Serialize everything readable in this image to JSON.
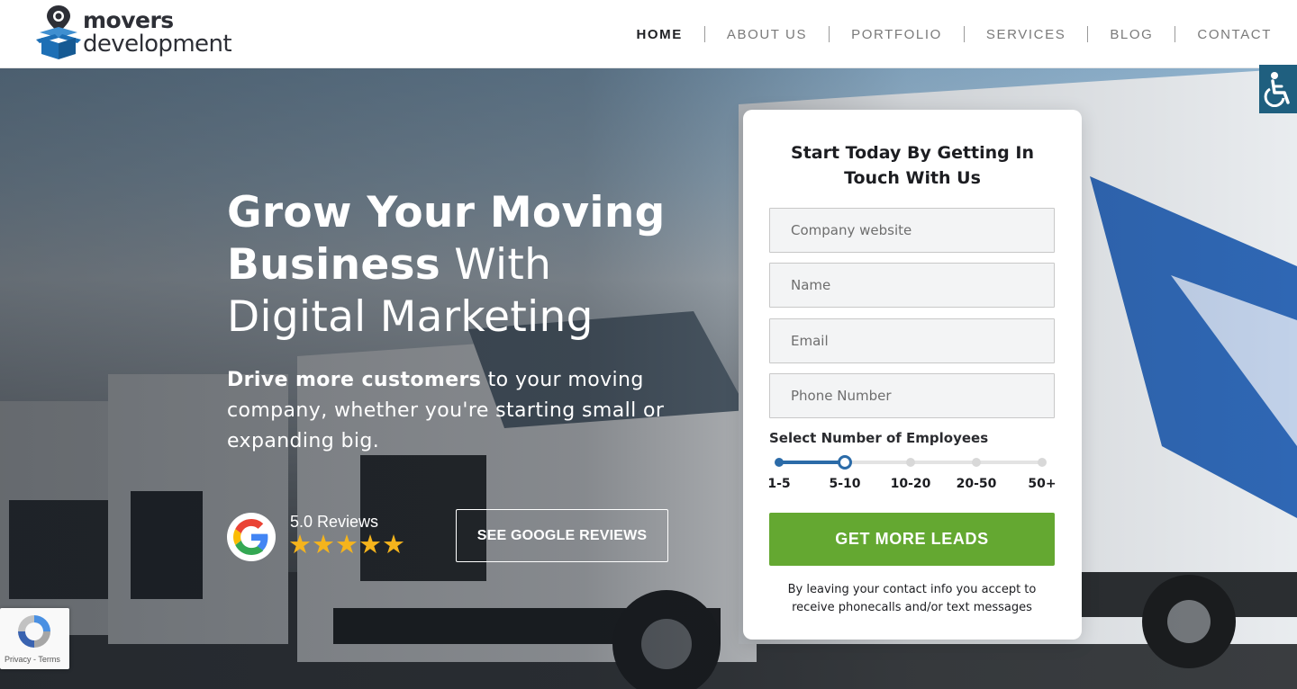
{
  "brand": {
    "line1": "movers",
    "line2": "development"
  },
  "nav": [
    {
      "label": "HOME",
      "active": true
    },
    {
      "label": "ABOUT US",
      "active": false
    },
    {
      "label": "PORTFOLIO",
      "active": false
    },
    {
      "label": "SERVICES",
      "active": false
    },
    {
      "label": "BLOG",
      "active": false
    },
    {
      "label": "CONTACT",
      "active": false
    }
  ],
  "hero": {
    "headline_bold_1": "Grow Your Moving",
    "headline_bold_2": "Business",
    "headline_light_2": " With",
    "headline_light_3": "Digital Marketing",
    "sub_bold": "Drive more customers",
    "sub_rest": " to your moving company, whether you're starting small or expanding big.",
    "reviews_text": "5.0 Reviews",
    "stars": "★★★★★",
    "reviews_button": "SEE GOOGLE REVIEWS"
  },
  "form": {
    "title": "Start Today By Getting In Touch With Us",
    "fields": [
      {
        "placeholder": "Company website",
        "value": ""
      },
      {
        "placeholder": "Name",
        "value": ""
      },
      {
        "placeholder": "Email",
        "value": ""
      },
      {
        "placeholder": "Phone Number",
        "value": ""
      }
    ],
    "employees_label": "Select Number of Employees",
    "employee_options": [
      "1-5",
      "5-10",
      "10-20",
      "20-50",
      "50+"
    ],
    "employees_selected": "5-10",
    "submit_label": "GET MORE LEADS",
    "disclaimer": "By leaving your contact info you accept to receive phonecalls and/or text messages"
  },
  "recaptcha": {
    "privacy": "Privacy",
    "separator": " - ",
    "terms": "Terms"
  },
  "colors": {
    "accent_green": "#64a831",
    "slider_blue": "#2b6ba8",
    "star_gold": "#f5b41c",
    "access_bg": "#1f5f7f"
  },
  "icons": {
    "accessibility": "wheelchair-icon",
    "google": "google-g-icon",
    "recaptcha": "recaptcha-icon"
  }
}
